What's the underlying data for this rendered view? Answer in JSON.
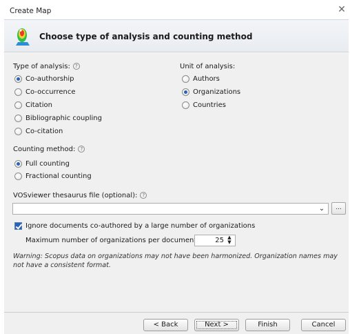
{
  "window": {
    "title": "Create Map",
    "close_icon": "close-icon"
  },
  "header": {
    "title": "Choose type of analysis and counting method",
    "icon": "vosviewer-map-icon"
  },
  "analysis": {
    "label": "Type of analysis:",
    "options": [
      "Co-authorship",
      "Co-occurrence",
      "Citation",
      "Bibliographic coupling",
      "Co-citation"
    ],
    "selected": "Co-authorship"
  },
  "unit": {
    "label": "Unit of analysis:",
    "options": [
      "Authors",
      "Organizations",
      "Countries"
    ],
    "selected": "Organizations"
  },
  "counting": {
    "label": "Counting method:",
    "options": [
      "Full counting",
      "Fractional counting"
    ],
    "selected": "Full counting"
  },
  "thesaurus": {
    "label": "VOSviewer thesaurus file (optional):",
    "value": "",
    "browse_label": "..."
  },
  "ignore_docs": {
    "label": "Ignore documents co-authored by a large number of organizations",
    "checked": true,
    "max_label": "Maximum number of organizations per document:",
    "max_value": "25"
  },
  "warning": "Warning: Scopus data on organizations may not have been harmonized. Organization names may not have a consistent format.",
  "buttons": {
    "back": "< Back",
    "next": "Next >",
    "finish": "Finish",
    "cancel": "Cancel"
  },
  "colors": {
    "accent": "#2a63b5"
  }
}
